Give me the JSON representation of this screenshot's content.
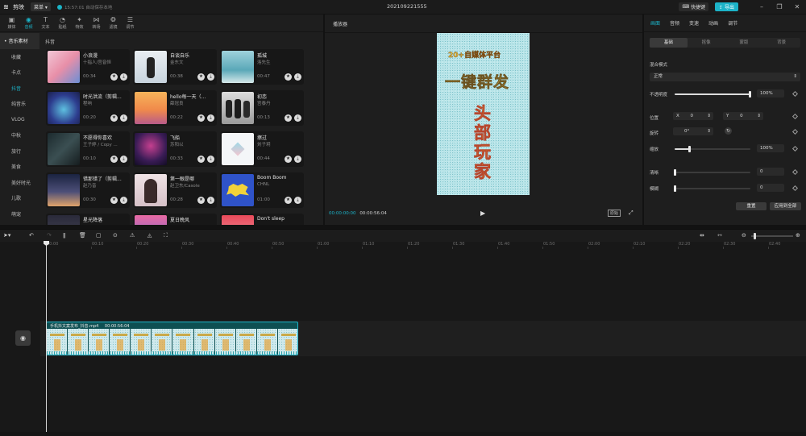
{
  "topbar": {
    "app_name": "剪映",
    "menu_label": "菜单",
    "autosave": "15:57:01 自动保存本地",
    "project_title": "202109221555",
    "shortcut_label": "快捷键",
    "export_label": "导出"
  },
  "toolbar": [
    {
      "label": "媒体",
      "icon": "media-icon"
    },
    {
      "label": "音频",
      "icon": "audio-icon"
    },
    {
      "label": "文本",
      "icon": "text-icon"
    },
    {
      "label": "贴纸",
      "icon": "sticker-icon"
    },
    {
      "label": "特效",
      "icon": "effect-icon"
    },
    {
      "label": "转场",
      "icon": "transition-icon"
    },
    {
      "label": "滤镜",
      "icon": "filter-icon"
    },
    {
      "label": "调节",
      "icon": "adjust-icon"
    }
  ],
  "sidebar": [
    "• 音乐素材",
    "收藏",
    "卡点",
    "抖音",
    "纯音乐",
    "VLOG",
    "中秋",
    "旅行",
    "美食",
    "美好时光",
    "儿歌",
    "萌宠"
  ],
  "section_title": "抖音",
  "songs": [
    {
      "title": "小浪漫",
      "artist": "十指人/宫音恒",
      "duration": "00:34"
    },
    {
      "title": "自谈自乐",
      "artist": "金东文",
      "duration": "00:38"
    },
    {
      "title": "孤城",
      "artist": "洛先生",
      "duration": "00:47"
    },
    {
      "title": "时光洪流（剪辑...",
      "artist": "程响",
      "duration": "00:20"
    },
    {
      "title": "hello每一天（...",
      "artist": "薛冠良",
      "duration": "00:22"
    },
    {
      "title": "初恋",
      "artist": "宫泰丹",
      "duration": "00:13"
    },
    {
      "title": "不愿得你喜欢",
      "artist": "王子婷 / Copy ...",
      "duration": "00:10"
    },
    {
      "title": "飞船",
      "artist": "苏阳以",
      "duration": "00:33"
    },
    {
      "title": "擦过",
      "artist": "刘子玥",
      "duration": "00:44"
    },
    {
      "title": "错那错了（剪辑...",
      "artist": "赵乃音",
      "duration": "00:30"
    },
    {
      "title": "第一眼是哪",
      "artist": "赵卫东/Casole",
      "duration": "00:28"
    },
    {
      "title": "Boom Boom",
      "artist": "CHNL",
      "duration": "01:00"
    },
    {
      "title": "星光降落",
      "artist": "",
      "duration": ""
    },
    {
      "title": "夏日晚风",
      "artist": "",
      "duration": ""
    },
    {
      "title": "Don't sleep",
      "artist": "",
      "duration": ""
    }
  ],
  "player": {
    "title": "播放器",
    "canvas_line1": "20+自媒体平台",
    "canvas_line2": "一键群发",
    "canvas_vertical": [
      "头",
      "部",
      "玩",
      "家"
    ],
    "time_current": "00:00:00:00",
    "time_total": "00:00:56:04",
    "ratio_label": "原始"
  },
  "props": {
    "tabs": [
      "画面",
      "音频",
      "变速",
      "动画",
      "调节"
    ],
    "subtabs": [
      "基础",
      "抠像",
      "蒙版",
      "背景"
    ],
    "blend_mode_label": "混合模式",
    "blend_mode_value": "正常",
    "opacity_label": "不透明度",
    "opacity_value": "100%",
    "opacity_level": 1.0,
    "position_label": "位置",
    "pos_x_label": "X",
    "pos_x": "0",
    "pos_y_label": "Y",
    "pos_y": "0",
    "rotate_label": "旋转",
    "rotate_value": "0°",
    "scale_label": "缩放",
    "scale_value": "100%",
    "scale_level": 0.2,
    "clarity_label": "清晰",
    "clarity_value": "0",
    "blur_label": "模糊",
    "blur_value": "0",
    "reset_label": "重置",
    "apply_all_label": "应用到全部"
  },
  "timeline": {
    "ruler_labels": [
      "00:00",
      "00:10",
      "00:20",
      "00:30",
      "00:40",
      "00:50",
      "01:00",
      "01:10",
      "01:20",
      "01:30",
      "01:40",
      "01:50",
      "02:00",
      "02:10",
      "02:20",
      "02:30",
      "02:40"
    ],
    "clip_name": "手机抖文案发布_抖音.mp4",
    "clip_duration": "00:00:56:04"
  }
}
